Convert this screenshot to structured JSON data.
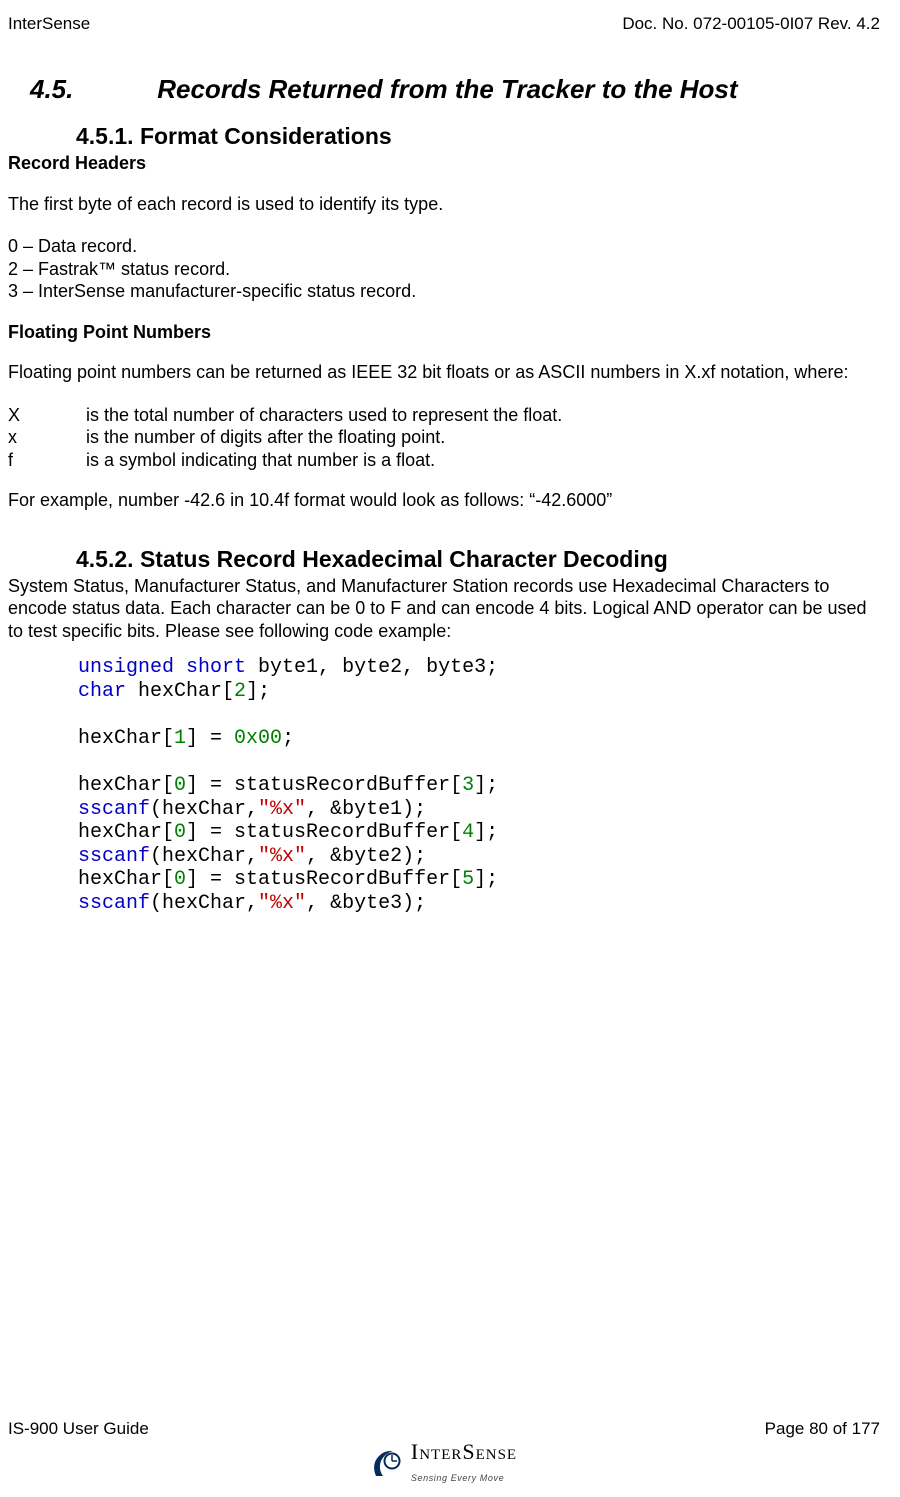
{
  "header": {
    "left": "InterSense",
    "right": "Doc. No. 072-00105-0I07 Rev. 4.2"
  },
  "section": {
    "num": "4.5.",
    "title": "Records Returned from the Tracker to the Host"
  },
  "sub1": {
    "num": "4.5.1.",
    "title": "Format Considerations",
    "h1": "Record Headers",
    "p1": "The first byte of each record is used to identify its type.",
    "list": [
      "0 – Data record.",
      "2 – Fastrak™ status record.",
      "3 – InterSense manufacturer-specific status record."
    ],
    "h2": "Floating Point Numbers",
    "p2": "Floating point numbers can be returned as IEEE 32 bit floats or as ASCII numbers in X.xf notation, where:",
    "defs": [
      {
        "k": "X",
        "v": "is the total number of characters used to represent the float."
      },
      {
        "k": "x",
        "v": "is the number of digits after the floating point."
      },
      {
        "k": "f",
        "v": "is a symbol indicating that number is a float."
      }
    ],
    "p3": "For example, number -42.6 in 10.4f format would look as follows: “-42.6000”"
  },
  "sub2": {
    "num": "4.5.2.",
    "title": "Status Record Hexadecimal Character Decoding",
    "p1": "System Status, Manufacturer Status, and Manufacturer Station records use Hexadecimal Characters to encode status data.  Each character can be 0 to F and can encode 4 bits.  Logical AND operator can be used to test specific bits.  Please see following code example:",
    "code": {
      "l1a": "unsigned",
      "l1b": "short",
      "l1c": " byte1, byte2, byte3;",
      "l2a": "char",
      "l2b": " hexChar[",
      "l2n": "2",
      "l2c": "];",
      "l3a": "hexChar[",
      "l3n": "1",
      "l3b": "] = ",
      "l3v": "0x00",
      "l3c": ";",
      "l4a": "hexChar[",
      "l4n": "0",
      "l4b": "] = statusRecordBuffer[",
      "l4m": "3",
      "l4c": "];",
      "l5a": "sscanf",
      "l5b": "(hexChar,",
      "l5s": "\"%x\"",
      "l5c": ", &byte1);",
      "l6a": "hexChar[",
      "l6n": "0",
      "l6b": "] = statusRecordBuffer[",
      "l6m": "4",
      "l6c": "];",
      "l7a": "sscanf",
      "l7b": "(hexChar,",
      "l7s": "\"%x\"",
      "l7c": ", &byte2);",
      "l8a": "hexChar[",
      "l8n": "0",
      "l8b": "] = statusRecordBuffer[",
      "l8m": "5",
      "l8c": "];",
      "l9a": "sscanf",
      "l9b": "(hexChar,",
      "l9s": "\"%x\"",
      "l9c": ", &byte3);"
    }
  },
  "footer": {
    "left": "IS-900 User Guide",
    "right": "Page 80 of 177",
    "logo_main": "InterSense",
    "logo_tag": "Sensing Every Move"
  }
}
